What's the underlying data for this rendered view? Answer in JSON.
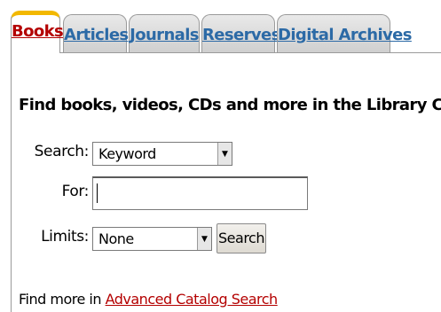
{
  "tabs": [
    {
      "label": "Books",
      "active": true
    },
    {
      "label": "Articles",
      "active": false
    },
    {
      "label": "Journals",
      "active": false
    },
    {
      "label": "Reserves",
      "active": false
    },
    {
      "label": "Digital Archives",
      "active": false
    }
  ],
  "colors": {
    "active_tab_accent": "#f2b800",
    "active_tab_text": "#b40000",
    "tab_text": "#2c6aa6",
    "link": "#b40000"
  },
  "heading": "Find books, videos, CDs and more in the Library Catalog",
  "form": {
    "search_label": "Search:",
    "search_value": "Keyword",
    "for_label": "For:",
    "for_value": "",
    "limits_label": "Limits:",
    "limits_value": "None",
    "search_button": "Search"
  },
  "footer": {
    "prefix": "Find more in ",
    "link": "Advanced Catalog Search"
  },
  "icons": {
    "dropdown_arrow": "chevron-down-icon"
  }
}
